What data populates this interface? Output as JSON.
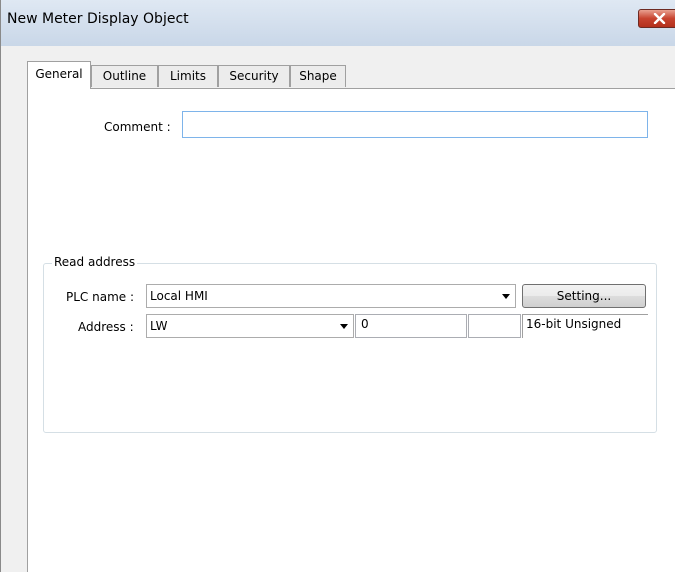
{
  "window": {
    "title": "New  Meter Display Object"
  },
  "tabs": [
    {
      "label": "General",
      "active": true
    },
    {
      "label": "Outline",
      "active": false
    },
    {
      "label": "Limits",
      "active": false
    },
    {
      "label": "Security",
      "active": false
    },
    {
      "label": "Shape",
      "active": false
    }
  ],
  "general": {
    "comment_label": "Comment :",
    "comment_value": "",
    "read_address": {
      "group_title": "Read address",
      "plc_name_label": "PLC name :",
      "plc_name_value": "Local HMI",
      "setting_button": "Setting...",
      "address_label": "Address :",
      "address_type_value": "LW",
      "address_value": "0",
      "address_extra_value": "",
      "data_format": "16-bit Unsigned"
    }
  },
  "colors": {
    "close_button": "#c7432f",
    "title_bar": "#c9d7e8",
    "focus_border": "#7eb4ea"
  },
  "icons": {
    "close": "close-icon",
    "dropdown": "chevron-down-icon"
  }
}
